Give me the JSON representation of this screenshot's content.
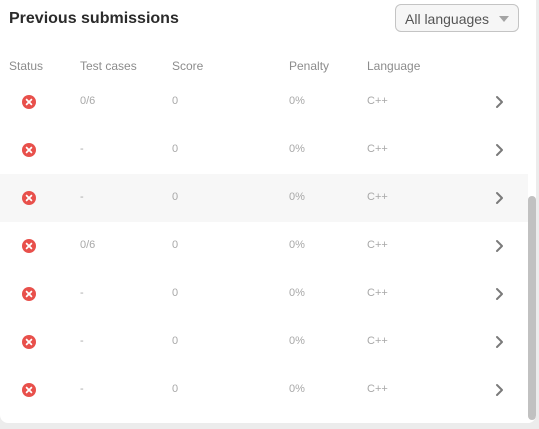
{
  "header": {
    "title": "Previous submissions",
    "language_filter": {
      "selected": "All languages"
    }
  },
  "table": {
    "columns": [
      "Status",
      "Test cases",
      "Score",
      "Penalty",
      "Language"
    ],
    "rows": [
      {
        "status": "failed",
        "test_cases": "0/6",
        "score": "0",
        "penalty": "0%",
        "language": "C++"
      },
      {
        "status": "failed",
        "test_cases": "-",
        "score": "0",
        "penalty": "0%",
        "language": "C++"
      },
      {
        "status": "failed",
        "test_cases": "-",
        "score": "0",
        "penalty": "0%",
        "language": "C++"
      },
      {
        "status": "failed",
        "test_cases": "0/6",
        "score": "0",
        "penalty": "0%",
        "language": "C++"
      },
      {
        "status": "failed",
        "test_cases": "-",
        "score": "0",
        "penalty": "0%",
        "language": "C++"
      },
      {
        "status": "failed",
        "test_cases": "-",
        "score": "0",
        "penalty": "0%",
        "language": "C++"
      },
      {
        "status": "failed",
        "test_cases": "-",
        "score": "0",
        "penalty": "0%",
        "language": "C++"
      }
    ]
  },
  "icons": {
    "status": "error-circle-icon",
    "row_action": "chevron-right-icon",
    "dropdown": "caret-down-icon"
  },
  "colors": {
    "error": "#e8504b",
    "title": "#2b2b2b",
    "muted_text": "#a8a8a8"
  }
}
